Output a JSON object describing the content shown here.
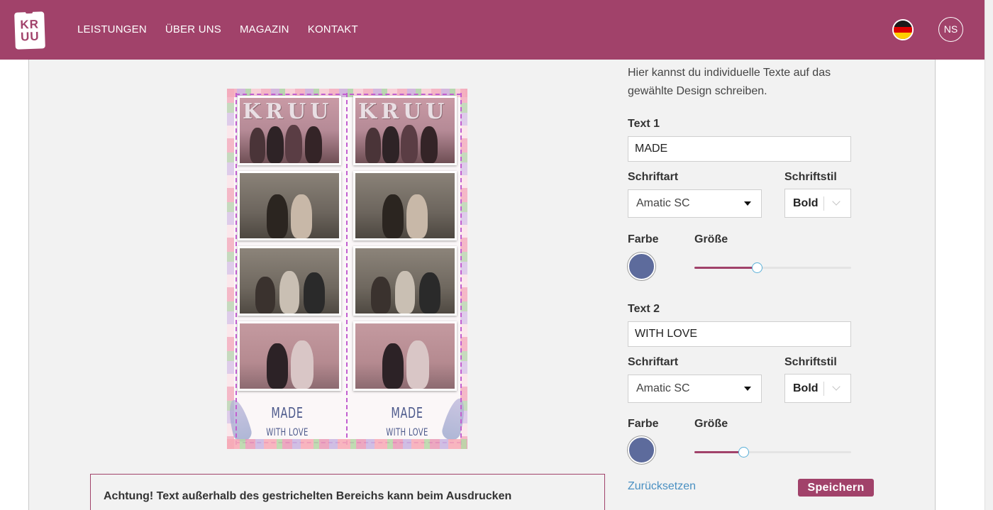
{
  "header": {
    "logo_text": "KRUU",
    "nav": [
      "LEISTUNGEN",
      "ÜBER UNS",
      "MAGAZIN",
      "KONTAKT"
    ],
    "avatar_initials": "NS",
    "language_flag": "german-flag-icon",
    "bg_color": "#a1426a"
  },
  "preview": {
    "line1": "MADE",
    "line2": "WITH LOVE",
    "photo_sign": "KRUU"
  },
  "warning": {
    "text": "Achtung! Text außerhalb des gestrichelten Bereichs kann beim Ausdrucken"
  },
  "form": {
    "intro": "Hier kannst du individuelle Texte auf das gewählte Design schreiben.",
    "text1": {
      "label": "Text 1",
      "value": "MADE",
      "font_label": "Schriftart",
      "font_value": "Amatic SC",
      "style_label": "Schriftstil",
      "style_value": "Bold",
      "color_label": "Farbe",
      "color": "#5d6b9c",
      "size_label": "Größe",
      "size_fraction": 0.4
    },
    "text2": {
      "label": "Text 2",
      "value": "WITH LOVE",
      "font_label": "Schriftart",
      "font_value": "Amatic SC",
      "style_label": "Schriftstil",
      "style_value": "Bold",
      "color_label": "Farbe",
      "color": "#5d6b9c",
      "size_label": "Größe",
      "size_fraction": 0.31
    },
    "reset_label": "Zurücksetzen",
    "save_label": "Speichern"
  }
}
